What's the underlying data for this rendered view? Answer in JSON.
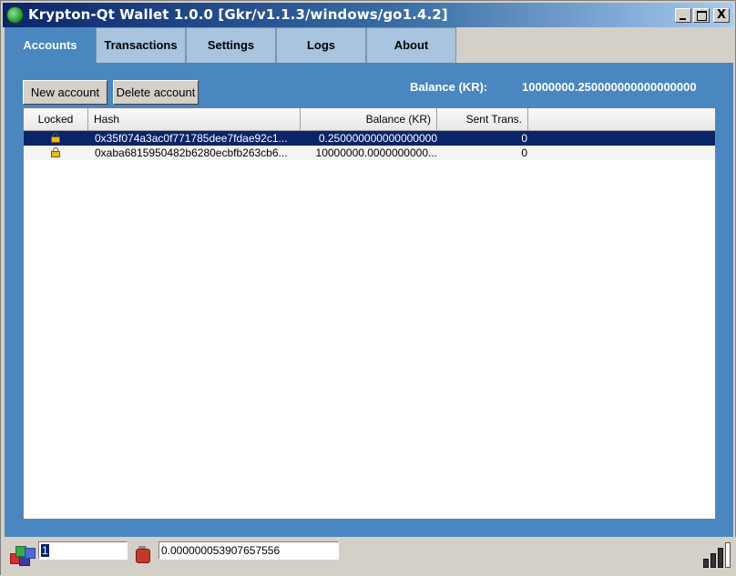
{
  "window": {
    "title": "Krypton-Qt Wallet 1.0.0 [Gkr/v1.1.3/windows/go1.4.2]",
    "controls": {
      "minimize": "_",
      "maximize": "□",
      "close": "X"
    }
  },
  "tabs": [
    {
      "label": "Accounts",
      "active": true
    },
    {
      "label": "Transactions",
      "active": false
    },
    {
      "label": "Settings",
      "active": false
    },
    {
      "label": "Logs",
      "active": false
    },
    {
      "label": "About",
      "active": false
    }
  ],
  "toolbar": {
    "new_account_label": "New account",
    "delete_account_label": "Delete account",
    "balance_label": "Balance (KR):",
    "balance_value": "10000000.250000000000000000"
  },
  "table": {
    "columns": [
      "Locked",
      "Hash",
      "Balance (KR)",
      "Sent Trans."
    ],
    "rows": [
      {
        "locked_icon": "lock-icon",
        "hash": "0x35f074a3ac0f771785dee7fdae92c1...",
        "balance": "0.250000000000000000",
        "sent": "0",
        "selected": true
      },
      {
        "locked_icon": "lock-icon",
        "hash": "0xaba6815950482b6280ecbfb263cb6...",
        "balance": "10000000.0000000000...",
        "sent": "0",
        "selected": false
      }
    ]
  },
  "statusbar": {
    "peers_icon": "network-cubes-icon",
    "peers_value": "1",
    "gas_icon": "fuel-can-icon",
    "gas_value": "0.000000053907657556",
    "signal_icon": "signal-strength-icon"
  },
  "colors": {
    "panel": "#4a86bf",
    "selection": "#0a246a",
    "tab_inactive": "#a8c4de"
  }
}
